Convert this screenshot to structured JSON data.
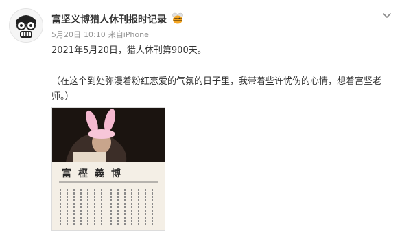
{
  "post": {
    "user_name": "富坚义博猎人休刊报时记录",
    "date": "5月20日",
    "time": "10:10",
    "source_prefix": "来自",
    "source": "iPhone",
    "text_line1": "2021年5月20日，猎人休刊第900天。",
    "text_paragraph": "（在这个到处弥漫着粉红恋爱的气氛的日子里，我带着些许忧伤的心情，想着富坚老师。）"
  },
  "image": {
    "caption_name": "富樫義博"
  },
  "icons": {
    "avatar": "cartoon-face-avatar",
    "badge": "vip-bee-badge-icon",
    "menu": "chevron-down-icon"
  },
  "colors": {
    "meta": "#939393",
    "text": "#333333",
    "badge": "#f5a623"
  }
}
